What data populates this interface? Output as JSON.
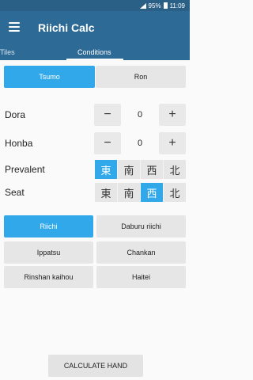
{
  "statusbar": {
    "battery": "95%",
    "time": "11:09"
  },
  "appbar": {
    "title": "Riichi Calc",
    "menu_icon": "hamburger-menu-icon"
  },
  "tabs": [
    {
      "label": "Tiles"
    },
    {
      "label": "Conditions"
    }
  ],
  "win_type": {
    "options": [
      "Tsumo",
      "Ron"
    ],
    "selected": "Tsumo"
  },
  "dora": {
    "label": "Dora",
    "value": "0",
    "minus": "−",
    "plus": "+"
  },
  "honba": {
    "label": "Honba",
    "value": "0",
    "minus": "−",
    "plus": "+"
  },
  "prevalent": {
    "label": "Prevalent",
    "winds": [
      "東",
      "南",
      "西",
      "北"
    ],
    "selected": "東"
  },
  "seat": {
    "label": "Seat",
    "winds": [
      "東",
      "南",
      "西",
      "北"
    ],
    "selected": "西"
  },
  "yaku": {
    "riichi": "Riichi",
    "daburu_riichi": "Daburu riichi",
    "ippatsu": "Ippatsu",
    "chankan": "Chankan",
    "rinshan_kaihou": "Rinshan kaihou",
    "haitei": "Haitei",
    "active": "Riichi"
  },
  "calculate_button": "CALCULATE HAND",
  "colors": {
    "primary": "#2d6a96",
    "accent": "#30a8ea"
  }
}
